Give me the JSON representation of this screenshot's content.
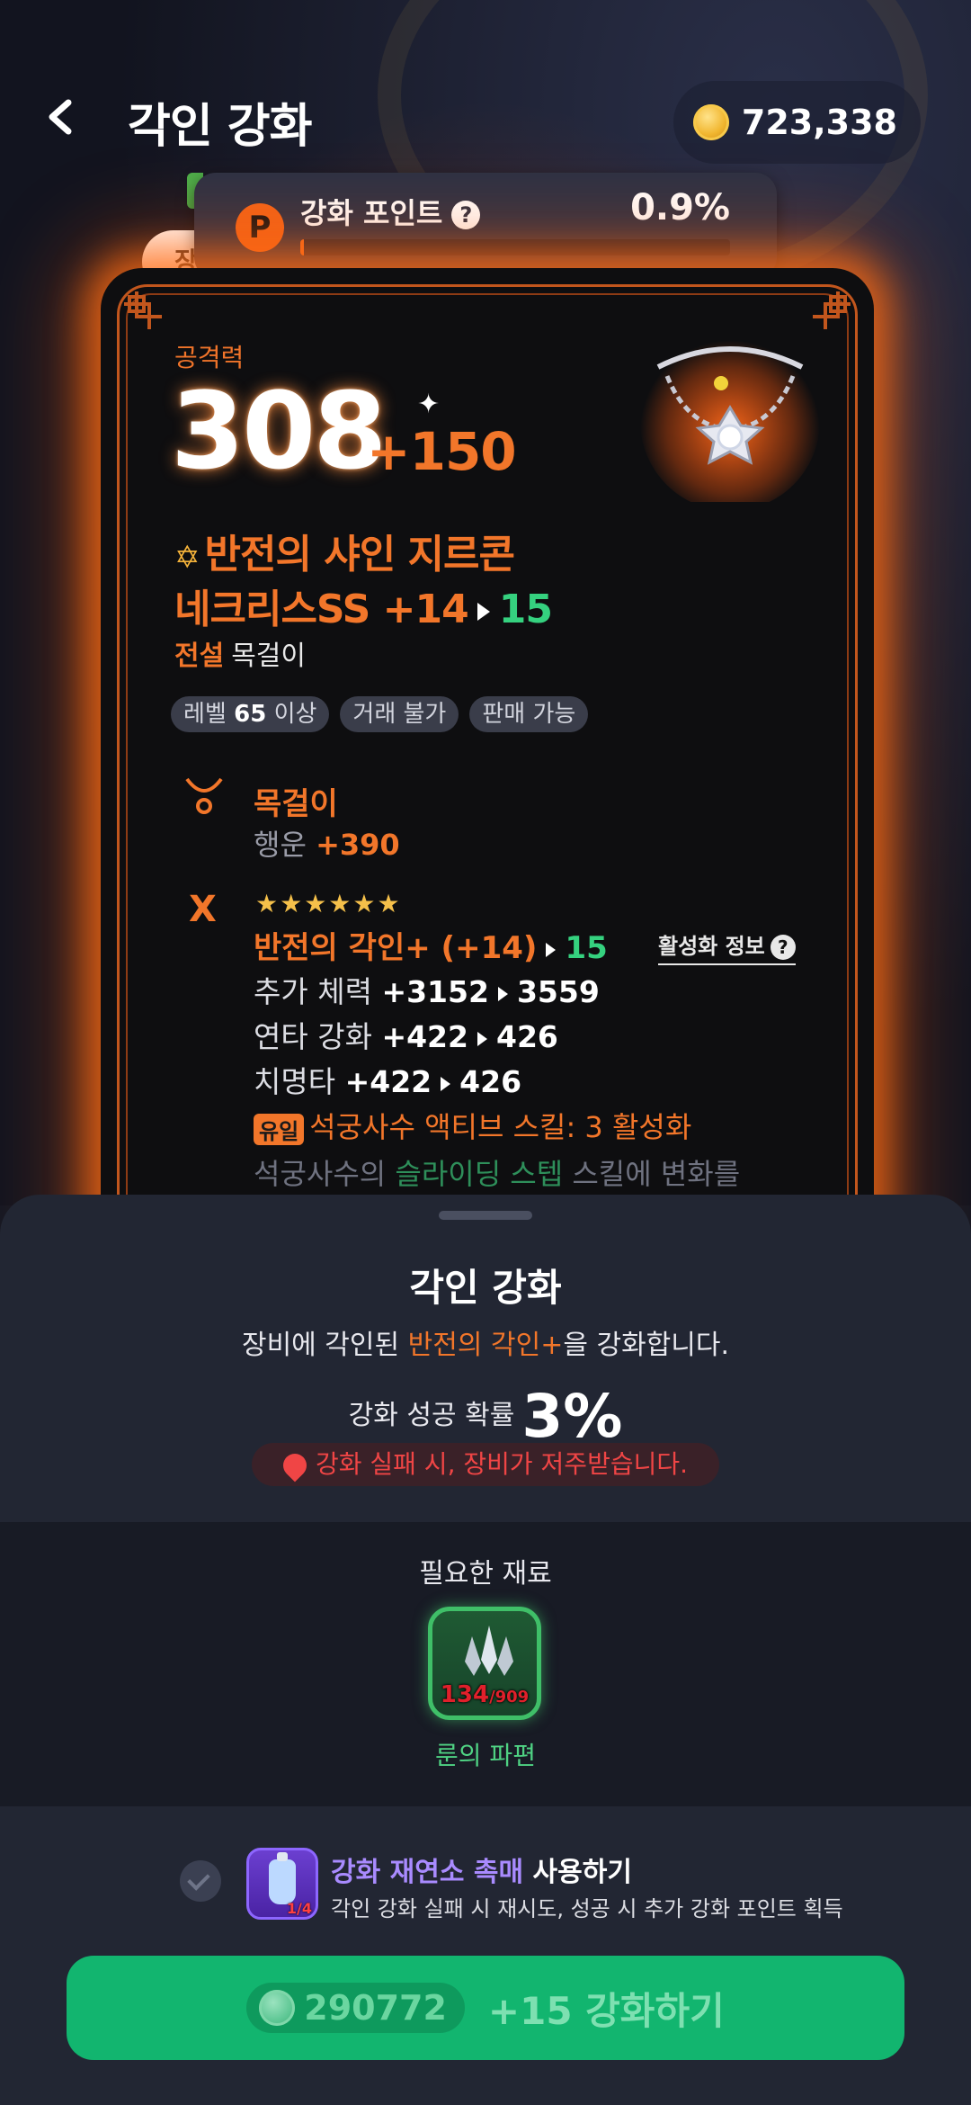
{
  "header": {
    "title": "각인 강화",
    "coins": "723,338"
  },
  "points": {
    "icon_letter": "P",
    "label": "강화 포인트",
    "percent": "0.9%",
    "fill_fraction": 0.009,
    "help": "?"
  },
  "equip_tab_partial": "장",
  "item": {
    "stat_label": "공격력",
    "stat_value": "308",
    "stat_bonus": "+150",
    "name_line1": "반전의 샤인 지르콘",
    "name_line2_prefix": "네크리스SS +14",
    "name_line2_next": "15",
    "grade": "전설",
    "type": "목걸이",
    "chip_level_prefix": "레벨",
    "chip_level_num": "65",
    "chip_level_suffix": "이상",
    "chip_trade": "거래 불가",
    "chip_sell": "판매 가능",
    "slot_title": "목걸이",
    "slot_stat_label": "행운",
    "slot_stat_value": "+390",
    "engrave_stars": "★★★★★★",
    "engrave_title": "반전의 각인+ (+14)",
    "engrave_next": "15",
    "activation_info": "활성화 정보",
    "stats": [
      {
        "label": "추가 체력",
        "from": "+3152",
        "to": "3559"
      },
      {
        "label": "연타 강화",
        "from": "+422",
        "to": "426"
      },
      {
        "label": "치명타",
        "from": "+422",
        "to": "426"
      }
    ],
    "unique_badge": "유일",
    "unique_text": "석궁사수 액티브 스킬: 3 활성화",
    "desc_prefix": "석궁사수의",
    "desc_skill": "슬라이딩 스텝",
    "desc_suffix": "스킬에 변화를"
  },
  "sheet": {
    "title": "각인 강화",
    "desc_prefix": "장비에 각인된",
    "desc_highlight": "반전의 각인+",
    "desc_suffix": "을 강화합니다.",
    "prob_label": "강화 성공 확률",
    "prob_value": "3%",
    "warning": "강화 실패 시, 장비가 저주받습니다.",
    "materials_title": "필요한 재료",
    "material_count": "134",
    "material_total": "/909",
    "material_name": "룬의 파편",
    "catalyst_highlight": "강화 재연소 촉매",
    "catalyst_suffix": "사용하기",
    "catalyst_count": "1/4",
    "catalyst_desc": "각인 강화 실패 시 재시도, 성공 시 추가 강화 포인트 획득",
    "cta_cost": "290772",
    "cta_label": "+15 강화하기"
  },
  "colors": {
    "accent_orange": "#f2762a",
    "success_green": "#35d17f",
    "cta_green": "#12b56f",
    "warning_red": "#f04545",
    "catalyst_purple": "#a98bff"
  }
}
